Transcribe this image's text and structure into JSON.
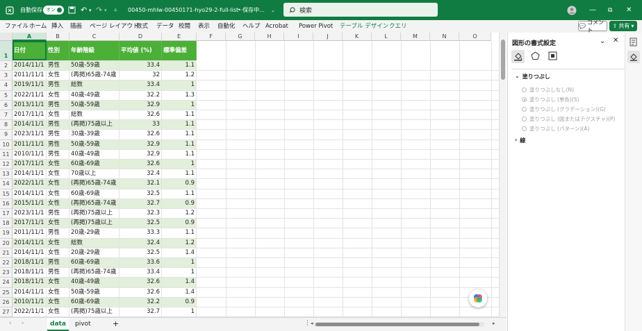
{
  "titlebar": {
    "autosave_label": "自動保存",
    "toggle_label": "オン",
    "doc_title": "00450-mhlw-00450171-hyo29-2-full-list···",
    "save_status": "• 保存中...",
    "search_placeholder": "検索"
  },
  "menu": {
    "items": [
      "ファイル",
      "ホーム",
      "挿入",
      "描画",
      "ページ レイアウト",
      "数式",
      "データ",
      "校閲",
      "表示",
      "自動化",
      "ヘルプ",
      "Acrobat",
      "Power Pivot",
      "テーブル デザイン",
      "クエリ"
    ],
    "comment_label": "コメント",
    "share_label": "共有"
  },
  "columns": [
    "A",
    "B",
    "C",
    "D",
    "E",
    "F",
    "G",
    "H",
    "I",
    "J",
    "K",
    "L",
    "M",
    "N",
    "O"
  ],
  "header_cells": [
    "日付",
    "性別",
    "年齢階級",
    "平均値 (%)",
    "標準偏差"
  ],
  "rows": [
    [
      "2014/11/1",
      "男性",
      "50歳-59歳",
      "33.4",
      "1.1"
    ],
    [
      "2011/11/1",
      "女性",
      "(再掲)65歳-74歳",
      "32",
      "1.2"
    ],
    [
      "2019/11/1",
      "男性",
      "総数",
      "33.4",
      "1"
    ],
    [
      "2022/11/1",
      "女性",
      "40歳-49歳",
      "32.2",
      "1.3"
    ],
    [
      "2013/11/1",
      "男性",
      "50歳-59歳",
      "32.9",
      "1"
    ],
    [
      "2017/11/1",
      "女性",
      "総数",
      "32.6",
      "1.1"
    ],
    [
      "2014/11/1",
      "男性",
      "(再掲)75歳以上",
      "33",
      "1.1"
    ],
    [
      "2023/11/1",
      "男性",
      "30歳-39歳",
      "32.6",
      "1.1"
    ],
    [
      "2011/11/1",
      "男性",
      "50歳-59歳",
      "32.9",
      "1.1"
    ],
    [
      "2010/11/1",
      "男性",
      "40歳-49歳",
      "32.9",
      "1.1"
    ],
    [
      "2017/11/1",
      "女性",
      "60歳-69歳",
      "32.6",
      "1"
    ],
    [
      "2014/11/1",
      "女性",
      "70歳以上",
      "32.4",
      "1.1"
    ],
    [
      "2022/11/1",
      "女性",
      "(再掲)65歳-74歳",
      "32.1",
      "0.9"
    ],
    [
      "2014/11/1",
      "女性",
      "60歳-69歳",
      "32.5",
      "1.1"
    ],
    [
      "2015/11/1",
      "女性",
      "(再掲)65歳-74歳",
      "32.7",
      "0.9"
    ],
    [
      "2023/11/1",
      "男性",
      "(再掲)75歳以上",
      "32.3",
      "1.2"
    ],
    [
      "2017/11/1",
      "女性",
      "(再掲)75歳以上",
      "32.5",
      "0.9"
    ],
    [
      "2011/11/1",
      "男性",
      "20歳-29歳",
      "33.3",
      "1.1"
    ],
    [
      "2014/11/1",
      "女性",
      "総数",
      "32.4",
      "1.2"
    ],
    [
      "2014/11/1",
      "女性",
      "20歳-29歳",
      "32.5",
      "1.4"
    ],
    [
      "2018/11/1",
      "男性",
      "60歳-69歳",
      "33.6",
      "1"
    ],
    [
      "2018/11/1",
      "男性",
      "(再掲)65歳-74歳",
      "33.4",
      "1"
    ],
    [
      "2018/11/1",
      "女性",
      "40歳-49歳",
      "32.6",
      "1.4"
    ],
    [
      "2014/11/1",
      "女性",
      "50歳-59歳",
      "32.6",
      "1.4"
    ],
    [
      "2010/11/1",
      "女性",
      "60歳-69歳",
      "32.2",
      "0.9"
    ],
    [
      "2022/11/1",
      "女性",
      "(再掲)75歳以上",
      "32.7",
      "1"
    ]
  ],
  "row_numbers": [
    "1",
    "2",
    "3",
    "4",
    "5",
    "6",
    "7",
    "8",
    "9",
    "10",
    "11",
    "12",
    "13",
    "14",
    "15",
    "16",
    "17",
    "18",
    "19",
    "20",
    "21",
    "22",
    "23",
    "24",
    "25",
    "26",
    "27"
  ],
  "tabs": {
    "sheets": [
      "data",
      "pivot"
    ],
    "active": "data",
    "add_label": "+"
  },
  "pane": {
    "title": "図形の書式設定",
    "section_fill": "塗りつぶし",
    "options": [
      "塗りつぶしなし(N)",
      "塗りつぶし (単色)(S)",
      "塗りつぶし (グラデーション)(G)",
      "塗りつぶし (図またはテクスチャ)(P)",
      "塗りつぶし (パターン)(A)"
    ],
    "section_line": "線"
  },
  "colors": {
    "brand": "#107c41",
    "header_fill": "#4caf37",
    "band_fill": "#e2efda"
  }
}
